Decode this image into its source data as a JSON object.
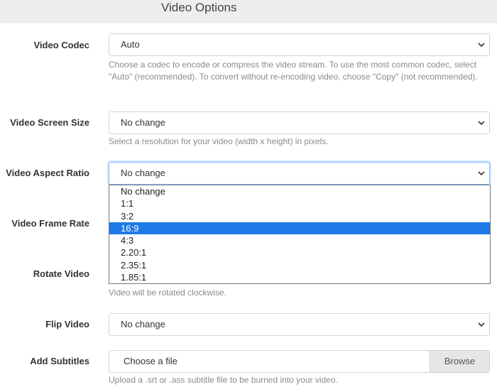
{
  "header": {
    "title": "Video Options"
  },
  "fields": {
    "codec": {
      "label": "Video Codec",
      "value": "Auto",
      "help": "Choose a codec to encode or compress the video stream. To use the most common codec, select \"Auto\" (recommended). To convert without re-encoding video, choose \"Copy\" (not recommended)."
    },
    "screen_size": {
      "label": "Video Screen Size",
      "value": "No change",
      "help": "Select a resolution for your video (width x height) in pixels."
    },
    "aspect_ratio": {
      "label": "Video Aspect Ratio",
      "value": "No change",
      "options": [
        "No change",
        "1:1",
        "3:2",
        "16:9",
        "4:3",
        "2.20:1",
        "2.35:1",
        "1.85:1"
      ],
      "highlighted_option": "16:9"
    },
    "frame_rate": {
      "label": "Video Frame Rate"
    },
    "rotate": {
      "label": "Rotate Video",
      "help": "Video will be rotated clockwise."
    },
    "flip": {
      "label": "Flip Video",
      "value": "No change"
    },
    "subtitles": {
      "label": "Add Subtitles",
      "placeholder": "Choose a file",
      "button": "Browse",
      "help": "Upload a .srt or .ass subtitle file to be burned into your video."
    }
  },
  "icons": {
    "select_arrow": "chevron-down-icon"
  }
}
